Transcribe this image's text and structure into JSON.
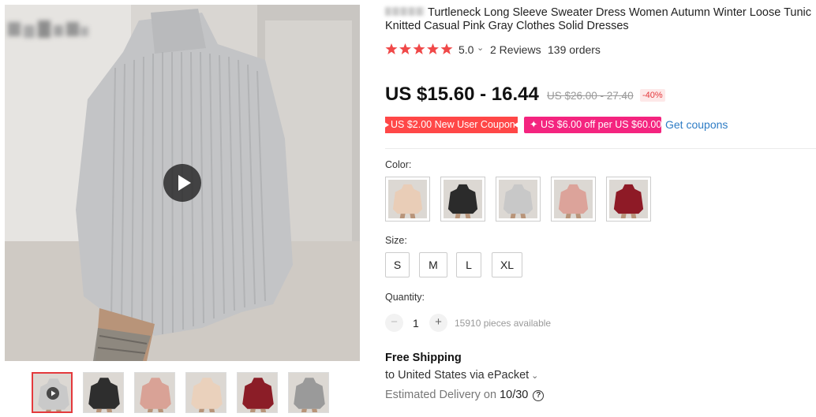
{
  "product": {
    "title": "Turtleneck Long Sleeve Sweater Dress Women Autumn Winter Loose Tunic Knitted Casual Pink Gray Clothes Solid Dresses"
  },
  "rating": {
    "score": "5.0",
    "stars": 5,
    "reviews": "2 Reviews",
    "orders": "139 orders"
  },
  "price": {
    "current": "US $15.60 - 16.44",
    "original": "US $26.00 - 27.40",
    "discount": "-40%"
  },
  "coupons": [
    {
      "label": "US $2.00 New User Coupon",
      "color": "#ff4747"
    },
    {
      "label": "✦ US $6.00 off per US $60.00",
      "color": "#f4247f"
    }
  ],
  "get_coupons_label": "Get coupons",
  "color": {
    "label": "Color:",
    "options": [
      {
        "name": "beige-icon",
        "fill": "#e9cdb7"
      },
      {
        "name": "black-icon",
        "fill": "#2b2b2b"
      },
      {
        "name": "gray-icon",
        "fill": "#c8c8c8"
      },
      {
        "name": "pink-icon",
        "fill": "#dca39a"
      },
      {
        "name": "wine-red-icon",
        "fill": "#8e1a26"
      }
    ]
  },
  "size": {
    "label": "Size:",
    "options": [
      "S",
      "M",
      "L",
      "XL"
    ]
  },
  "quantity": {
    "label": "Quantity:",
    "minus": "−",
    "plus": "+",
    "value": "1",
    "available": "15910 pieces available"
  },
  "shipping": {
    "title": "Free Shipping",
    "to": "to United States via ePacket",
    "chevron": "⌄",
    "delivery_prefix": "Estimated Delivery on",
    "delivery_date": "10/30",
    "help": "?"
  },
  "gallery": {
    "thumbnails": [
      {
        "name": "thumbnail-gray-video",
        "fill": "#c9c9c9"
      },
      {
        "name": "thumbnail-black",
        "fill": "#2e2e2e"
      },
      {
        "name": "thumbnail-pink",
        "fill": "#d9a296"
      },
      {
        "name": "thumbnail-beige",
        "fill": "#ead1bc"
      },
      {
        "name": "thumbnail-wine-red",
        "fill": "#8b1d27"
      },
      {
        "name": "thumbnail-multi",
        "fill": "#9a9a9a"
      }
    ]
  },
  "colors": {
    "accent": "#e4393c",
    "link": "#2e7cc5",
    "star": "#f04848"
  }
}
